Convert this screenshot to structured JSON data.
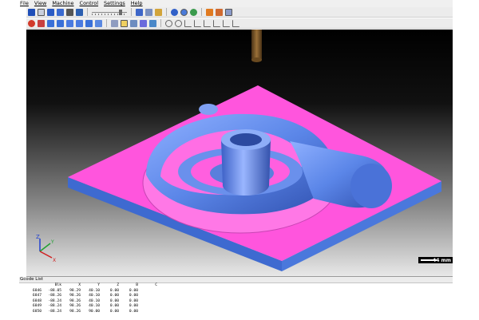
{
  "menu": [
    "File",
    "View",
    "Machine",
    "Control",
    "Settings",
    "Help"
  ],
  "scale_label": "44 mm",
  "axes": {
    "z": "Z",
    "y": "Y",
    "x": "X"
  },
  "list": {
    "title": "Gcode List",
    "headers": [
      "",
      "Blk",
      "X",
      "Y",
      "Z",
      "B",
      "C"
    ],
    "rows": [
      [
        "",
        "6846",
        "-88.05",
        "98.29",
        "40.10",
        "0.00",
        "0.00"
      ],
      [
        "",
        "6847",
        "-88.26",
        "98.26",
        "40.10",
        "0.00",
        "0.00"
      ],
      [
        "",
        "6848",
        "-88.24",
        "98.26",
        "40.10",
        "0.00",
        "0.00"
      ],
      [
        "",
        "6849",
        "-88.24",
        "98.26",
        "40.10",
        "0.00",
        "0.00"
      ],
      [
        "",
        "6850",
        "-88.24",
        "98.26",
        "90.00",
        "0.00",
        "0.00"
      ]
    ]
  },
  "colors": {
    "part_pink": "#ff55dd",
    "part_blue": "#5b86e8",
    "tool": "#7a5628"
  }
}
